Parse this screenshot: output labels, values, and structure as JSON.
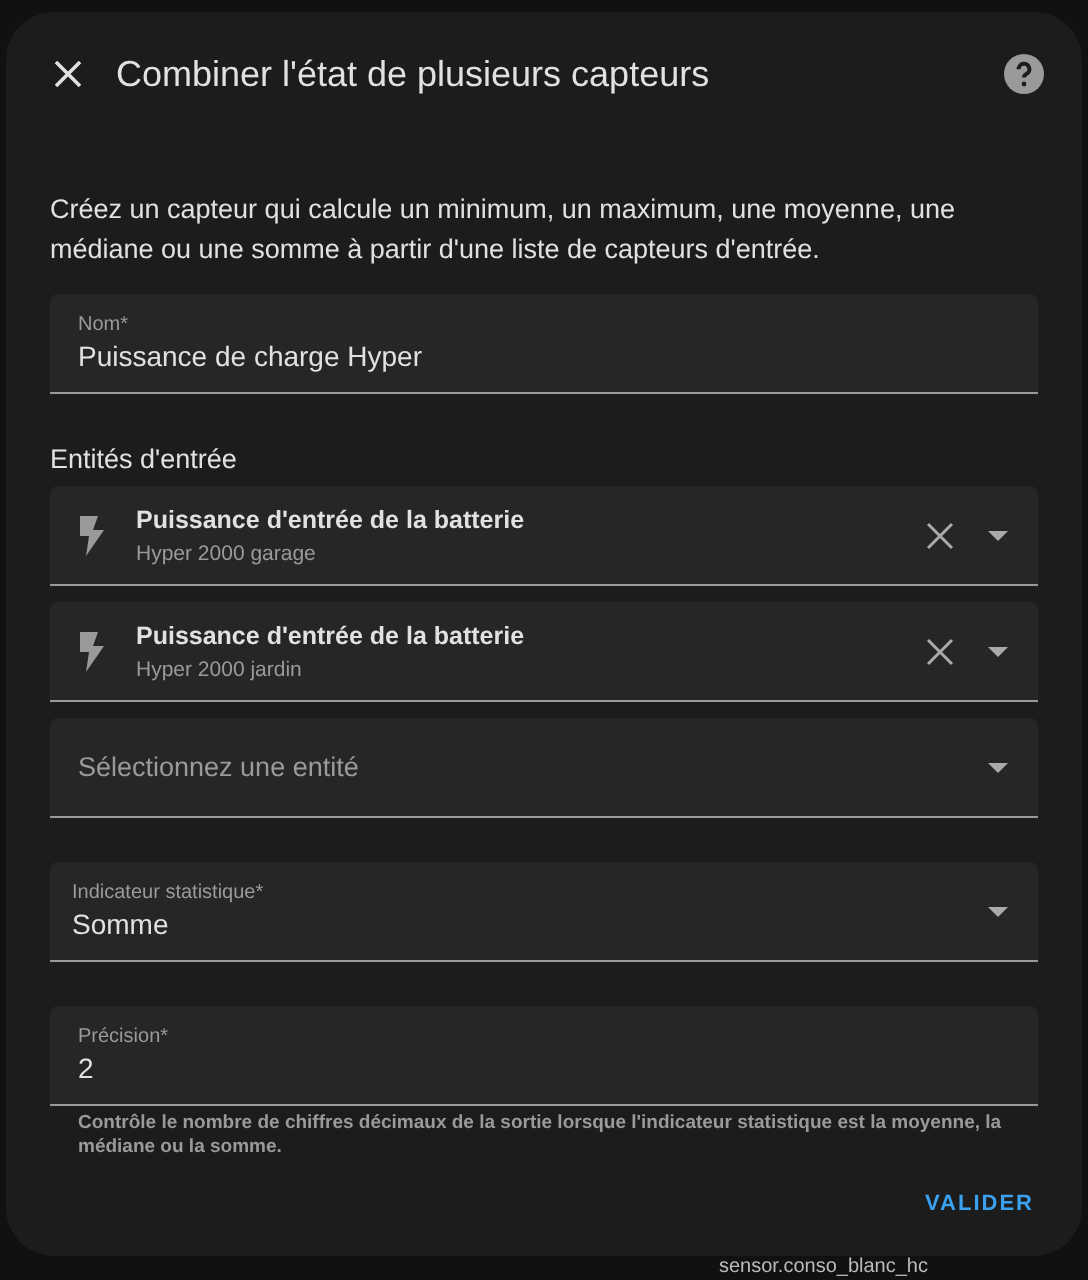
{
  "dialog": {
    "title": "Combiner l'état de plusieurs capteurs",
    "description": "Créez un capteur qui calcule un minimum, un maximum, une moyenne, une médiane ou une somme à partir d'une liste de capteurs d'entrée."
  },
  "name_field": {
    "label": "Nom*",
    "value": "Puissance de charge Hyper"
  },
  "entities": {
    "heading": "Entités d'entrée",
    "items": [
      {
        "name": "Puissance d'entrée de la batterie",
        "device": "Hyper 2000 garage"
      },
      {
        "name": "Puissance d'entrée de la batterie",
        "device": "Hyper 2000 jardin"
      }
    ],
    "picker": {
      "placeholder": "Sélectionnez une entité"
    }
  },
  "statistic_field": {
    "label": "Indicateur statistique*",
    "value": "Somme"
  },
  "precision_field": {
    "label": "Précision*",
    "value": "2",
    "helper": "Contrôle le nombre de chiffres décimaux de la sortie lorsque l'indicateur statistique est la moyenne, la médiane ou la somme."
  },
  "buttons": [
    "VALIDER"
  ],
  "background_text": "sensor.conso_blanc_hc"
}
